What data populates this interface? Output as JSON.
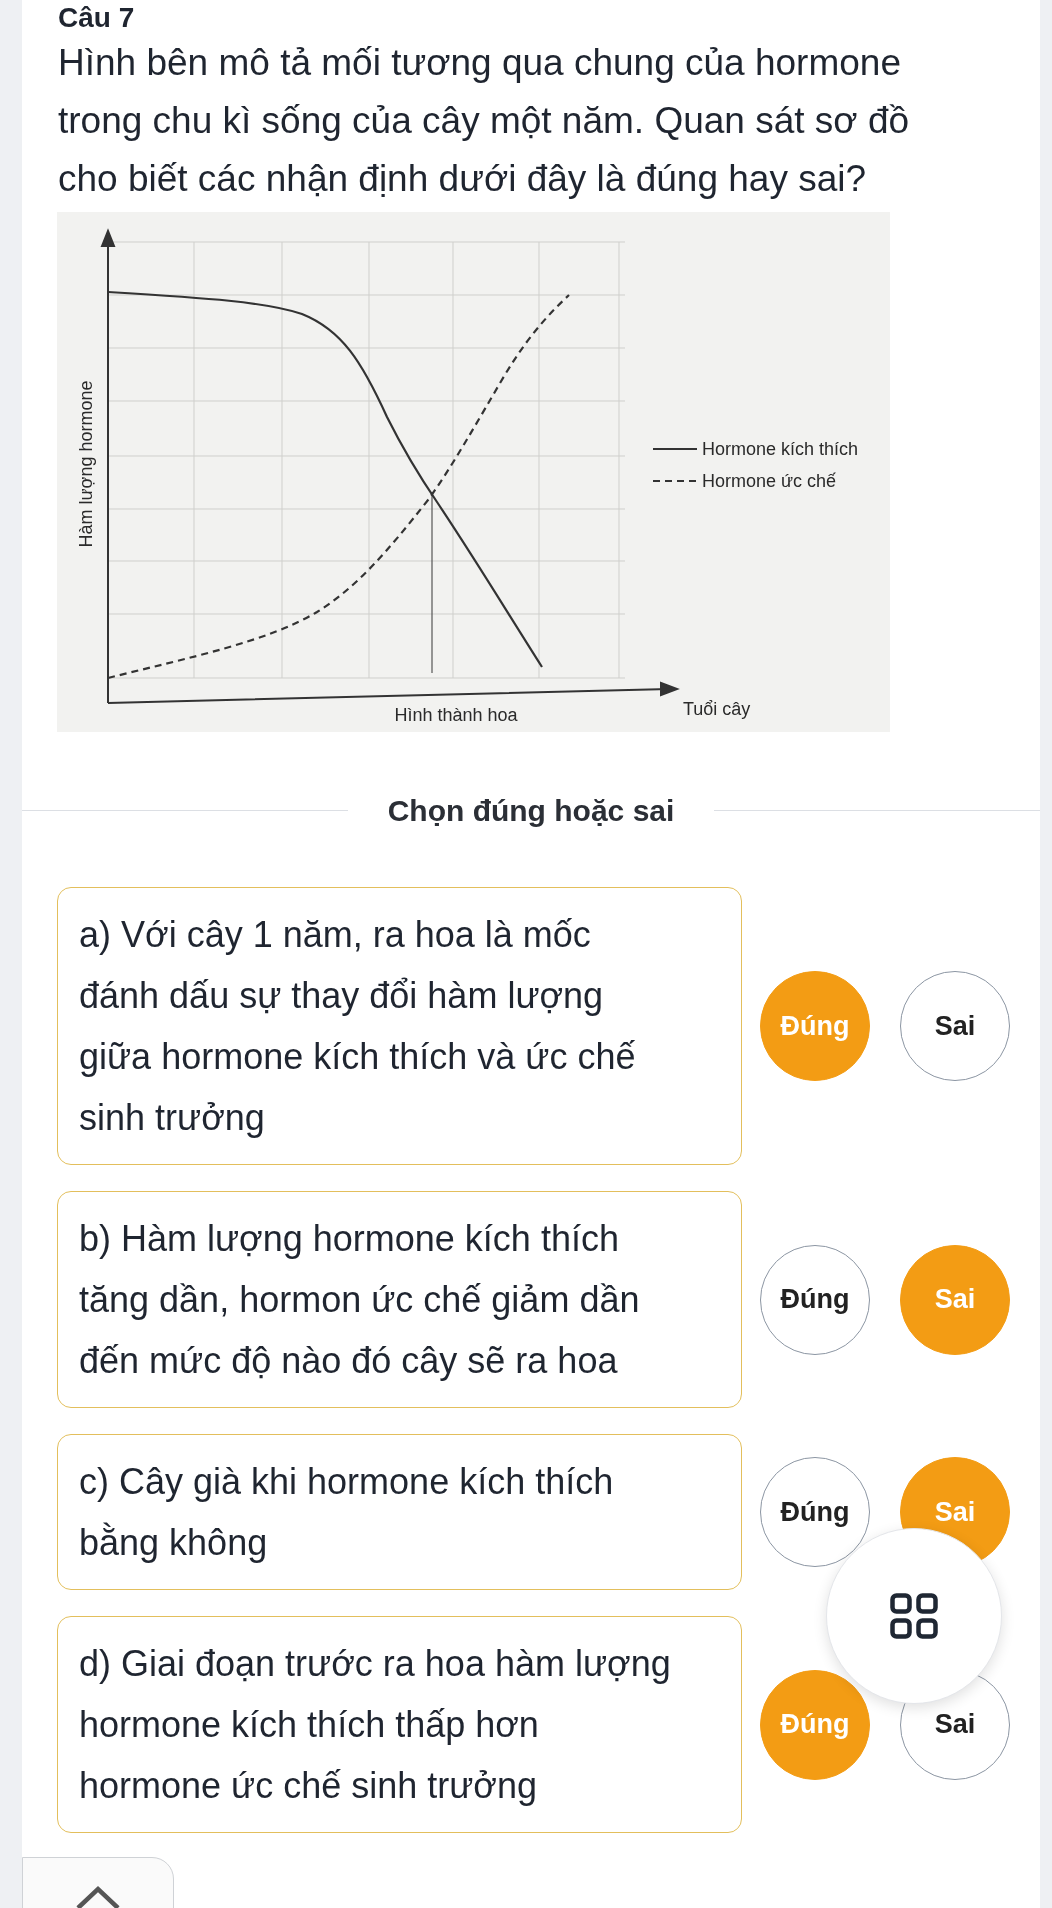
{
  "question": {
    "number": "Câu 7",
    "text": "Hình bên mô tả mối tương qua chung của hormone trong chu kì sống của cây một năm. Quan sát sơ đồ cho biết các nhận định dưới đây là đúng hay sai?"
  },
  "figure": {
    "y_label": "Hàm lượng hormone",
    "x_label": "Tuổi cây",
    "marker_label": "Hình thành hoa",
    "legend": [
      {
        "label": "Hormone kích thích",
        "kind": "solid"
      },
      {
        "label": "Hormone ức chế",
        "kind": "dashed"
      }
    ]
  },
  "section_title": "Chọn đúng hoặc sai",
  "statements": [
    {
      "text": "a) Với cây 1 năm, ra hoa là mốc đánh dấu sự thay đổi hàm lượng giữa hormone kích thích và ức chế sinh trưởng",
      "options": [
        {
          "label": "Đúng",
          "selected": true
        },
        {
          "label": "Sai",
          "selected": false
        }
      ]
    },
    {
      "text": "b) Hàm lượng hormone kích thích tăng dần, hormon ức chế giảm dần đến mức độ nào đó cây sẽ ra hoa",
      "options": [
        {
          "label": "Đúng",
          "selected": false
        },
        {
          "label": "Sai",
          "selected": true
        }
      ]
    },
    {
      "text": "c) Cây già khi hormone kích thích bằng không",
      "options": [
        {
          "label": "Đúng",
          "selected": false
        },
        {
          "label": "Sai",
          "selected": true
        }
      ]
    },
    {
      "text": "d) Giai đoạn trước ra hoa hàm lượng hormone kích thích thấp hơn hormone ức chế sinh trưởng",
      "options": [
        {
          "label": "Đúng",
          "selected": true
        },
        {
          "label": "Sai",
          "selected": false
        }
      ]
    }
  ]
}
